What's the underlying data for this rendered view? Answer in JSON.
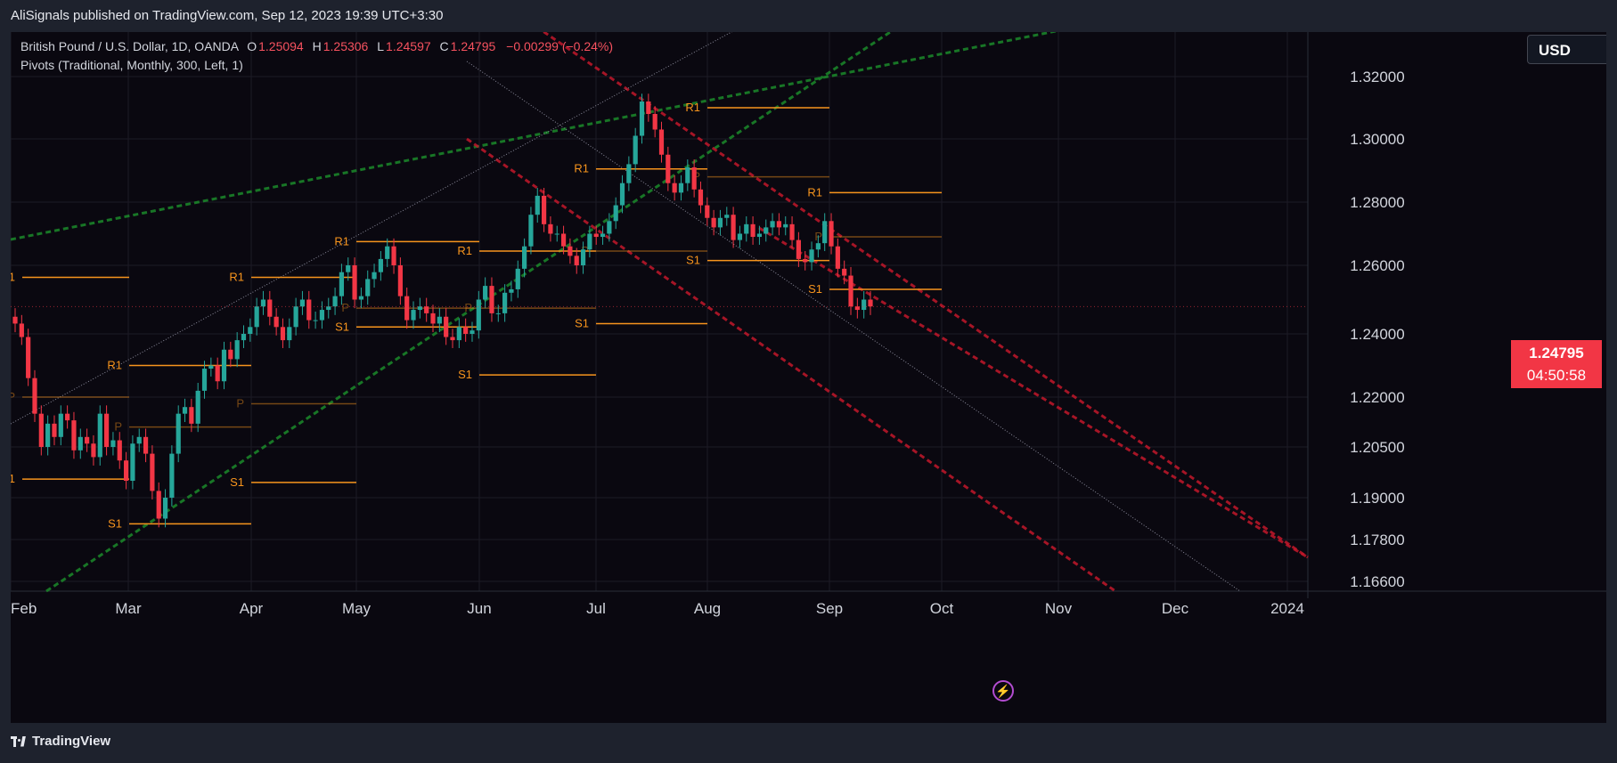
{
  "header": {
    "publisher_line": "AliSignals published on TradingView.com, Sep 12, 2023 19:39 UTC+3:30"
  },
  "legend": {
    "symbol": "British Pound / U.S. Dollar, 1D, OANDA",
    "o_label": "O",
    "o_value": "1.25094",
    "h_label": "H",
    "h_value": "1.25306",
    "l_label": "L",
    "l_value": "1.24597",
    "c_label": "C",
    "c_value": "1.24795",
    "change": "−0.00299 (−0.24%)",
    "indicator": "Pivots (Traditional, Monthly, 300, Left, 1)"
  },
  "currency_button": "USD",
  "last_price": {
    "price": "1.24795",
    "countdown": "04:50:58"
  },
  "footer": {
    "brand": "TradingView"
  },
  "icons": {
    "flash": "flash-icon",
    "brand_mark": "tradingview-logo-icon"
  },
  "colors": {
    "background": "#0a0810",
    "bull": "#26a69a",
    "bear": "#f23645",
    "pivot": "#f7941d",
    "channel_green": "#1b8a2a",
    "channel_red": "#c2182a",
    "price_badge": "#f23645"
  },
  "chart_data": {
    "type": "candlestick",
    "title": "British Pound / U.S. Dollar, 1D, OANDA",
    "y_ticks": [
      "1.32000",
      "1.30000",
      "1.28000",
      "1.26000",
      "1.24000",
      "1.22000",
      "1.20500",
      "1.19000",
      "1.17800",
      "1.16600"
    ],
    "x_ticks": [
      "Feb",
      "Mar",
      "Apr",
      "May",
      "Jun",
      "Jul",
      "Aug",
      "Sep",
      "Oct",
      "Nov",
      "Dec",
      "2024"
    ],
    "ylim": [
      1.164,
      1.325
    ],
    "grid": true,
    "pivot_levels": [
      {
        "month": "Feb",
        "R1": 1.2565,
        "P": 1.22,
        "S1": 1.1955
      },
      {
        "month": "Mar",
        "R1": 1.23,
        "P": 1.211,
        "S1": 1.1825
      },
      {
        "month": "Apr",
        "R1": 1.2565,
        "P": 1.218,
        "S1": 1.1945
      },
      {
        "month": "May",
        "R1": 1.2675,
        "P": 1.2475,
        "S1": 1.242
      },
      {
        "month": "Jun",
        "R1": 1.2645,
        "P": 1.2475,
        "S1": 1.227
      },
      {
        "month": "Jul",
        "R1": 1.2905,
        "P": 1.2645,
        "S1": 1.243
      },
      {
        "month": "Aug",
        "R1": 1.31,
        "P": 1.288,
        "S1": 1.2615
      },
      {
        "month": "Sep",
        "R1": 1.283,
        "P": 1.269,
        "S1": 1.253
      }
    ],
    "candles_close": [
      1.243,
      1.239,
      1.226,
      1.215,
      1.205,
      1.212,
      1.208,
      1.215,
      1.213,
      1.204,
      1.208,
      1.206,
      1.202,
      1.215,
      1.205,
      1.207,
      1.201,
      1.195,
      1.206,
      1.208,
      1.203,
      1.192,
      1.184,
      1.19,
      1.203,
      1.215,
      1.217,
      1.212,
      1.222,
      1.229,
      1.23,
      1.225,
      1.235,
      1.232,
      1.238,
      1.24,
      1.242,
      1.248,
      1.25,
      1.245,
      1.242,
      1.238,
      1.242,
      1.248,
      1.25,
      1.244,
      1.244,
      1.247,
      1.248,
      1.251,
      1.258,
      1.26,
      1.25,
      1.251,
      1.256,
      1.258,
      1.262,
      1.266,
      1.26,
      1.251,
      1.244,
      1.247,
      1.248,
      1.246,
      1.243,
      1.245,
      1.239,
      1.238,
      1.242,
      1.24,
      1.241,
      1.25,
      1.254,
      1.246,
      1.246,
      1.252,
      1.253,
      1.259,
      1.266,
      1.276,
      1.282,
      1.273,
      1.27,
      1.27,
      1.266,
      1.263,
      1.26,
      1.265,
      1.27,
      1.269,
      1.27,
      1.274,
      1.279,
      1.286,
      1.292,
      1.301,
      1.312,
      1.308,
      1.303,
      1.295,
      1.286,
      1.283,
      1.286,
      1.291,
      1.284,
      1.279,
      1.275,
      1.272,
      1.275,
      1.276,
      1.268,
      1.27,
      1.273,
      1.269,
      1.27,
      1.272,
      1.274,
      1.272,
      1.273,
      1.268,
      1.262,
      1.261,
      1.265,
      1.267,
      1.274,
      1.266,
      1.259,
      1.257,
      1.248,
      1.247,
      1.25,
      1.248
    ]
  }
}
